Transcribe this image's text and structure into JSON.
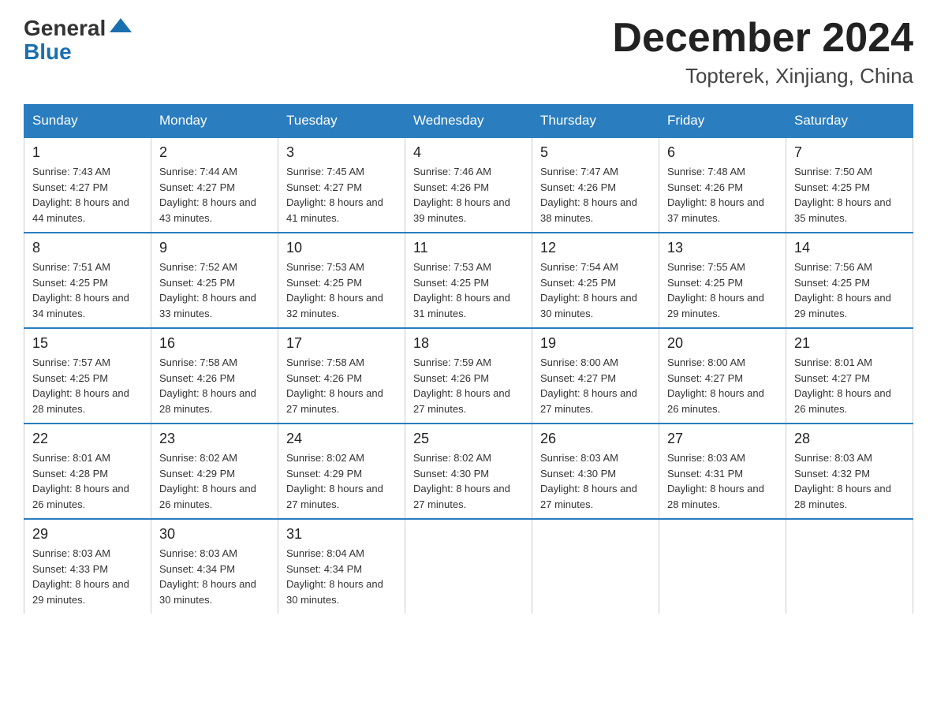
{
  "header": {
    "logo_general": "General",
    "logo_blue": "Blue",
    "title": "December 2024",
    "subtitle": "Topterek, Xinjiang, China"
  },
  "days_of_week": [
    "Sunday",
    "Monday",
    "Tuesday",
    "Wednesday",
    "Thursday",
    "Friday",
    "Saturday"
  ],
  "weeks": [
    [
      {
        "day": "1",
        "sunrise": "7:43 AM",
        "sunset": "4:27 PM",
        "daylight": "8 hours and 44 minutes."
      },
      {
        "day": "2",
        "sunrise": "7:44 AM",
        "sunset": "4:27 PM",
        "daylight": "8 hours and 43 minutes."
      },
      {
        "day": "3",
        "sunrise": "7:45 AM",
        "sunset": "4:27 PM",
        "daylight": "8 hours and 41 minutes."
      },
      {
        "day": "4",
        "sunrise": "7:46 AM",
        "sunset": "4:26 PM",
        "daylight": "8 hours and 39 minutes."
      },
      {
        "day": "5",
        "sunrise": "7:47 AM",
        "sunset": "4:26 PM",
        "daylight": "8 hours and 38 minutes."
      },
      {
        "day": "6",
        "sunrise": "7:48 AM",
        "sunset": "4:26 PM",
        "daylight": "8 hours and 37 minutes."
      },
      {
        "day": "7",
        "sunrise": "7:50 AM",
        "sunset": "4:25 PM",
        "daylight": "8 hours and 35 minutes."
      }
    ],
    [
      {
        "day": "8",
        "sunrise": "7:51 AM",
        "sunset": "4:25 PM",
        "daylight": "8 hours and 34 minutes."
      },
      {
        "day": "9",
        "sunrise": "7:52 AM",
        "sunset": "4:25 PM",
        "daylight": "8 hours and 33 minutes."
      },
      {
        "day": "10",
        "sunrise": "7:53 AM",
        "sunset": "4:25 PM",
        "daylight": "8 hours and 32 minutes."
      },
      {
        "day": "11",
        "sunrise": "7:53 AM",
        "sunset": "4:25 PM",
        "daylight": "8 hours and 31 minutes."
      },
      {
        "day": "12",
        "sunrise": "7:54 AM",
        "sunset": "4:25 PM",
        "daylight": "8 hours and 30 minutes."
      },
      {
        "day": "13",
        "sunrise": "7:55 AM",
        "sunset": "4:25 PM",
        "daylight": "8 hours and 29 minutes."
      },
      {
        "day": "14",
        "sunrise": "7:56 AM",
        "sunset": "4:25 PM",
        "daylight": "8 hours and 29 minutes."
      }
    ],
    [
      {
        "day": "15",
        "sunrise": "7:57 AM",
        "sunset": "4:25 PM",
        "daylight": "8 hours and 28 minutes."
      },
      {
        "day": "16",
        "sunrise": "7:58 AM",
        "sunset": "4:26 PM",
        "daylight": "8 hours and 28 minutes."
      },
      {
        "day": "17",
        "sunrise": "7:58 AM",
        "sunset": "4:26 PM",
        "daylight": "8 hours and 27 minutes."
      },
      {
        "day": "18",
        "sunrise": "7:59 AM",
        "sunset": "4:26 PM",
        "daylight": "8 hours and 27 minutes."
      },
      {
        "day": "19",
        "sunrise": "8:00 AM",
        "sunset": "4:27 PM",
        "daylight": "8 hours and 27 minutes."
      },
      {
        "day": "20",
        "sunrise": "8:00 AM",
        "sunset": "4:27 PM",
        "daylight": "8 hours and 26 minutes."
      },
      {
        "day": "21",
        "sunrise": "8:01 AM",
        "sunset": "4:27 PM",
        "daylight": "8 hours and 26 minutes."
      }
    ],
    [
      {
        "day": "22",
        "sunrise": "8:01 AM",
        "sunset": "4:28 PM",
        "daylight": "8 hours and 26 minutes."
      },
      {
        "day": "23",
        "sunrise": "8:02 AM",
        "sunset": "4:29 PM",
        "daylight": "8 hours and 26 minutes."
      },
      {
        "day": "24",
        "sunrise": "8:02 AM",
        "sunset": "4:29 PM",
        "daylight": "8 hours and 27 minutes."
      },
      {
        "day": "25",
        "sunrise": "8:02 AM",
        "sunset": "4:30 PM",
        "daylight": "8 hours and 27 minutes."
      },
      {
        "day": "26",
        "sunrise": "8:03 AM",
        "sunset": "4:30 PM",
        "daylight": "8 hours and 27 minutes."
      },
      {
        "day": "27",
        "sunrise": "8:03 AM",
        "sunset": "4:31 PM",
        "daylight": "8 hours and 28 minutes."
      },
      {
        "day": "28",
        "sunrise": "8:03 AM",
        "sunset": "4:32 PM",
        "daylight": "8 hours and 28 minutes."
      }
    ],
    [
      {
        "day": "29",
        "sunrise": "8:03 AM",
        "sunset": "4:33 PM",
        "daylight": "8 hours and 29 minutes."
      },
      {
        "day": "30",
        "sunrise": "8:03 AM",
        "sunset": "4:34 PM",
        "daylight": "8 hours and 30 minutes."
      },
      {
        "day": "31",
        "sunrise": "8:04 AM",
        "sunset": "4:34 PM",
        "daylight": "8 hours and 30 minutes."
      },
      null,
      null,
      null,
      null
    ]
  ]
}
